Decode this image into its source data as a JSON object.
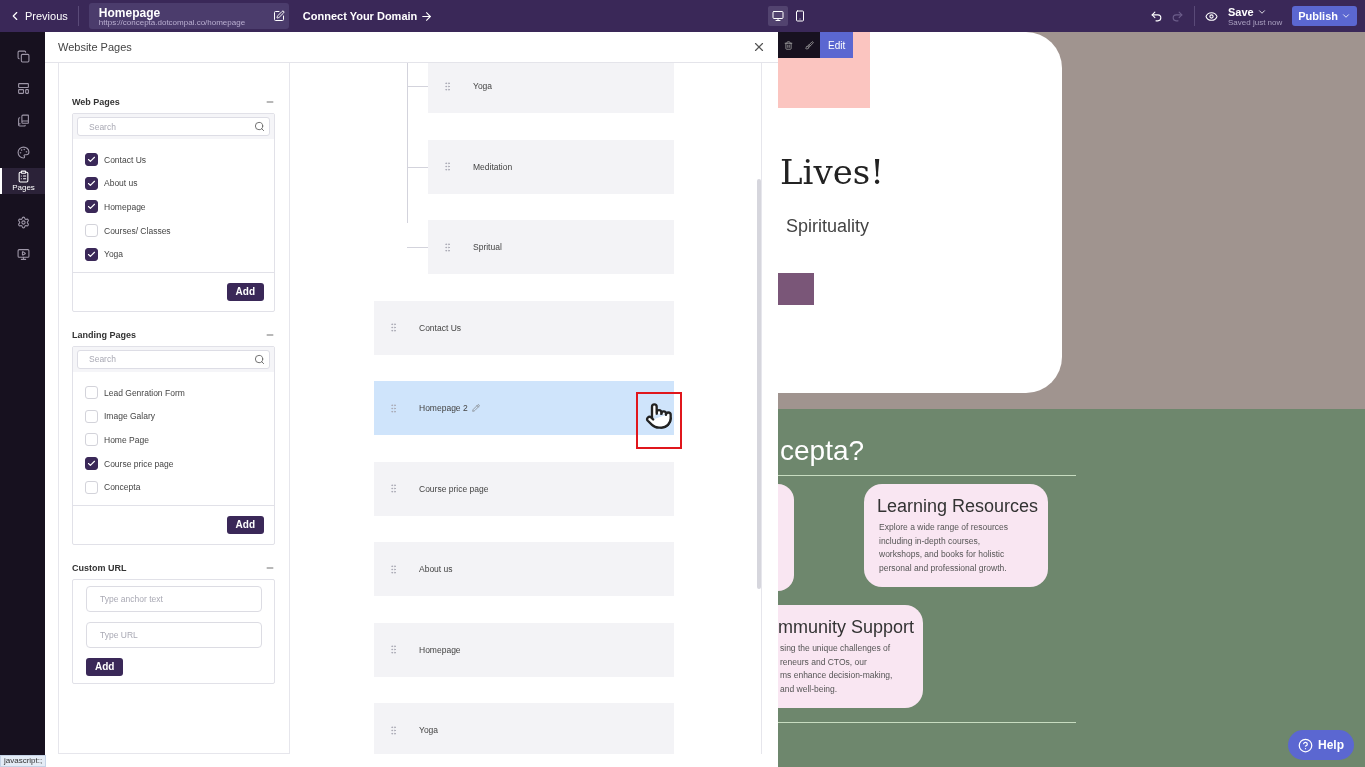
{
  "topbar": {
    "back": "Previous",
    "page_title": "Homepage",
    "page_url": "https://concepta.dotcompal.co/homepage",
    "connect": "Connect Your Domain",
    "devices": [
      {
        "kind": "desktop",
        "selected": true
      },
      {
        "kind": "mobile",
        "selected": false
      }
    ],
    "undo_disabled": false,
    "redo_disabled": true,
    "save": "Save",
    "save_status": "Saved just now",
    "publish": "Publish"
  },
  "rail": [
    {
      "kind": "pages-stack",
      "selected": false
    },
    {
      "kind": "layout",
      "selected": false
    },
    {
      "kind": "books",
      "selected": false
    },
    {
      "kind": "palette",
      "selected": false
    },
    {
      "kind": "clipboard",
      "label": "Pages",
      "selected": true
    },
    {
      "kind": "settings",
      "selected": false
    },
    {
      "kind": "monitor",
      "selected": false
    }
  ],
  "panel": {
    "title": "Website Pages",
    "sections": [
      {
        "kind": "list",
        "title": "Web Pages",
        "placeholder": "Search",
        "button": "Add",
        "items": [
          {
            "label": "Contact Us",
            "checked": true
          },
          {
            "label": "About us",
            "checked": true
          },
          {
            "label": "Homepage",
            "checked": true
          },
          {
            "label": "Courses/ Classes",
            "checked": false
          },
          {
            "label": "Yoga",
            "checked": true
          }
        ]
      },
      {
        "kind": "list",
        "title": "Landing Pages",
        "placeholder": "Search",
        "button": "Add",
        "items": [
          {
            "label": "Lead Genration Form",
            "checked": false
          },
          {
            "label": "Image Galary",
            "checked": false
          },
          {
            "label": "Home Page",
            "checked": false
          },
          {
            "label": "Course price page",
            "checked": true
          },
          {
            "label": "Concepta",
            "checked": false
          }
        ]
      },
      {
        "kind": "custom",
        "title": "Custom URL",
        "fields": [
          {
            "placeholder": "Type anchor text"
          },
          {
            "placeholder": "Type URL"
          }
        ],
        "button": "Add"
      }
    ],
    "tree": [
      {
        "children": [
          {
            "label": "Yoga",
            "selected": false
          },
          {
            "label": "Meditation",
            "selected": false
          },
          {
            "label": "Spritual",
            "selected": false
          }
        ]
      },
      {
        "label": "Contact Us",
        "selected": false
      },
      {
        "label": "Homepage 2",
        "selected": true
      },
      {
        "label": "Course price page",
        "selected": false
      },
      {
        "label": "About us",
        "selected": false
      },
      {
        "label": "Homepage",
        "selected": false
      },
      {
        "label": "Yoga",
        "selected": false
      }
    ]
  },
  "preview": {
    "edit_button": "Edit",
    "hero_heading": "Lives!",
    "hero_subheading": "Spirituality",
    "section_heading": "cepta?",
    "cards": [
      {
        "title": "Learning Resources",
        "lines": [
          "Explore a wide range of resources",
          "including in-depth courses,",
          "workshops, and books for holistic",
          "personal and professional growth."
        ]
      },
      {
        "title": "mmunity Support",
        "lines": [
          "sing the unique challenges of",
          "reneurs and CTOs, our",
          "ms enhance decision-making,",
          "and well-being."
        ]
      }
    ],
    "help": "Help"
  },
  "status_bar": "javascript:;"
}
